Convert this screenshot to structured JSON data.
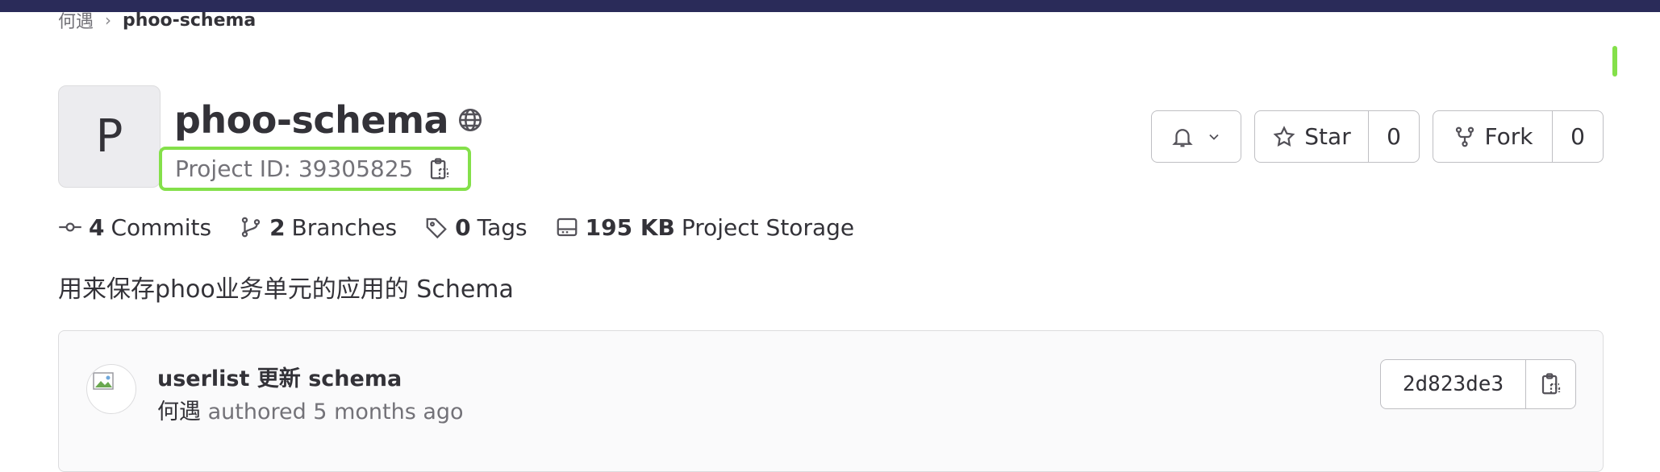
{
  "breadcrumb": {
    "owner": "何遇",
    "separator": "›",
    "current": "phoo-schema"
  },
  "project": {
    "avatar_letter": "P",
    "name": "phoo-schema",
    "visibility_icon": "globe-icon",
    "id_label": "Project ID: 39305825"
  },
  "actions": {
    "notification_icon": "bell-icon",
    "star_label": "Star",
    "star_count": "0",
    "fork_label": "Fork",
    "fork_count": "0"
  },
  "stats": {
    "commits_count": "4",
    "commits_label": "Commits",
    "branches_count": "2",
    "branches_label": "Branches",
    "tags_count": "0",
    "tags_label": "Tags",
    "storage_size": "195 KB",
    "storage_label": "Project Storage"
  },
  "description": "用来保存phoo业务单元的应用的 Schema",
  "last_commit": {
    "title": "userlist 更新 schema",
    "author": "何遇",
    "meta": "authored 5 months ago",
    "sha": "2d823de3"
  },
  "colors": {
    "topbar": "#2a2b59",
    "highlight": "#84e04a",
    "text": "#333238",
    "muted": "#737278"
  }
}
